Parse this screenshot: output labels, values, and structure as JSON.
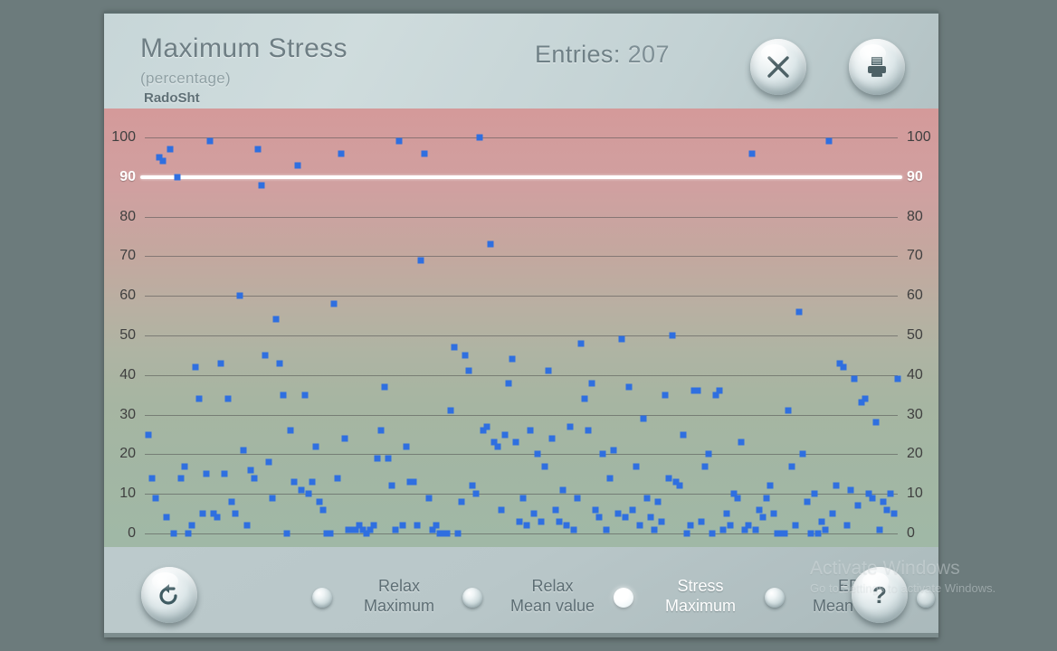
{
  "app": {
    "background_color": "#6c7b7c",
    "window_bg": "#b9c6c8"
  },
  "header": {
    "title": "Maximum Stress",
    "subtitle": "(percentage)",
    "username": "RadoSht",
    "entries_label": "Entries:",
    "entries_value": "207",
    "close_button": "close-icon",
    "print_button": "print-icon"
  },
  "footer": {
    "reset_button": "reset-icon",
    "help_button": "help-icon",
    "options": [
      {
        "line1": "Relax",
        "line2": "Maximum",
        "active": false
      },
      {
        "line1": "Relax",
        "line2": "Mean value",
        "active": false
      },
      {
        "line1": "Stress",
        "line2": "Maximum",
        "active": true
      },
      {
        "line1": "EDA",
        "line2": "Mean value",
        "active": false
      }
    ]
  },
  "watermark": {
    "line1": "Activate Windows",
    "line2": "Go to Settings to activate Windows."
  },
  "chart_data": {
    "type": "scatter",
    "title": "Maximum Stress",
    "subtitle": "(percentage)",
    "xlabel": "",
    "ylabel": "percentage",
    "ylim": [
      0,
      100
    ],
    "yticks": [
      0,
      10,
      20,
      30,
      40,
      50,
      60,
      70,
      80,
      90,
      100
    ],
    "grid": true,
    "legend": "none",
    "marker_color": "#2f6fe0",
    "marker_shape": "square",
    "threshold": {
      "value": 90,
      "color": "#ffffff",
      "label": "90"
    },
    "point_count": 207,
    "x_range": [
      0,
      207
    ],
    "points": [
      [
        1,
        25
      ],
      [
        2,
        14
      ],
      [
        3,
        9
      ],
      [
        4,
        95
      ],
      [
        5,
        94
      ],
      [
        6,
        4
      ],
      [
        7,
        97
      ],
      [
        8,
        0
      ],
      [
        9,
        90
      ],
      [
        10,
        14
      ],
      [
        11,
        17
      ],
      [
        12,
        0
      ],
      [
        13,
        2
      ],
      [
        14,
        42
      ],
      [
        15,
        34
      ],
      [
        16,
        5
      ],
      [
        17,
        15
      ],
      [
        18,
        99
      ],
      [
        19,
        5
      ],
      [
        20,
        4
      ],
      [
        21,
        43
      ],
      [
        22,
        15
      ],
      [
        23,
        34
      ],
      [
        24,
        8
      ],
      [
        25,
        5
      ],
      [
        26,
        60
      ],
      [
        27,
        21
      ],
      [
        28,
        2
      ],
      [
        29,
        16
      ],
      [
        30,
        14
      ],
      [
        31,
        97
      ],
      [
        32,
        88
      ],
      [
        33,
        45
      ],
      [
        34,
        18
      ],
      [
        35,
        9
      ],
      [
        36,
        54
      ],
      [
        37,
        43
      ],
      [
        38,
        35
      ],
      [
        39,
        0
      ],
      [
        40,
        26
      ],
      [
        41,
        13
      ],
      [
        42,
        93
      ],
      [
        43,
        11
      ],
      [
        44,
        35
      ],
      [
        45,
        10
      ],
      [
        46,
        13
      ],
      [
        47,
        22
      ],
      [
        48,
        8
      ],
      [
        49,
        6
      ],
      [
        50,
        0
      ],
      [
        51,
        0
      ],
      [
        52,
        58
      ],
      [
        53,
        14
      ],
      [
        54,
        96
      ],
      [
        55,
        24
      ],
      [
        56,
        1
      ],
      [
        57,
        1
      ],
      [
        58,
        1
      ],
      [
        59,
        2
      ],
      [
        60,
        1
      ],
      [
        61,
        0
      ],
      [
        62,
        1
      ],
      [
        63,
        2
      ],
      [
        64,
        19
      ],
      [
        65,
        26
      ],
      [
        66,
        37
      ],
      [
        67,
        19
      ],
      [
        68,
        12
      ],
      [
        69,
        1
      ],
      [
        70,
        99
      ],
      [
        71,
        2
      ],
      [
        72,
        22
      ],
      [
        73,
        13
      ],
      [
        74,
        13
      ],
      [
        75,
        2
      ],
      [
        76,
        69
      ],
      [
        77,
        96
      ],
      [
        78,
        9
      ],
      [
        79,
        1
      ],
      [
        80,
        2
      ],
      [
        81,
        0
      ],
      [
        82,
        0
      ],
      [
        83,
        0
      ],
      [
        84,
        31
      ],
      [
        85,
        47
      ],
      [
        86,
        0
      ],
      [
        87,
        8
      ],
      [
        88,
        45
      ],
      [
        89,
        41
      ],
      [
        90,
        12
      ],
      [
        91,
        10
      ],
      [
        92,
        100
      ],
      [
        93,
        26
      ],
      [
        94,
        27
      ],
      [
        95,
        73
      ],
      [
        96,
        23
      ],
      [
        97,
        22
      ],
      [
        98,
        6
      ],
      [
        99,
        25
      ],
      [
        100,
        38
      ],
      [
        101,
        44
      ],
      [
        102,
        23
      ],
      [
        103,
        3
      ],
      [
        104,
        9
      ],
      [
        105,
        2
      ],
      [
        106,
        26
      ],
      [
        107,
        5
      ],
      [
        108,
        20
      ],
      [
        109,
        3
      ],
      [
        110,
        17
      ],
      [
        111,
        41
      ],
      [
        112,
        24
      ],
      [
        113,
        6
      ],
      [
        114,
        3
      ],
      [
        115,
        11
      ],
      [
        116,
        2
      ],
      [
        117,
        27
      ],
      [
        118,
        1
      ],
      [
        119,
        9
      ],
      [
        120,
        48
      ],
      [
        121,
        34
      ],
      [
        122,
        26
      ],
      [
        123,
        38
      ],
      [
        124,
        6
      ],
      [
        125,
        4
      ],
      [
        126,
        20
      ],
      [
        127,
        1
      ],
      [
        128,
        14
      ],
      [
        129,
        21
      ],
      [
        130,
        5
      ],
      [
        131,
        49
      ],
      [
        132,
        4
      ],
      [
        133,
        37
      ],
      [
        134,
        6
      ],
      [
        135,
        17
      ],
      [
        136,
        2
      ],
      [
        137,
        29
      ],
      [
        138,
        9
      ],
      [
        139,
        4
      ],
      [
        140,
        1
      ],
      [
        141,
        8
      ],
      [
        142,
        3
      ],
      [
        143,
        35
      ],
      [
        144,
        14
      ],
      [
        145,
        50
      ],
      [
        146,
        13
      ],
      [
        147,
        12
      ],
      [
        148,
        25
      ],
      [
        149,
        0
      ],
      [
        150,
        2
      ],
      [
        151,
        36
      ],
      [
        152,
        36
      ],
      [
        153,
        3
      ],
      [
        154,
        17
      ],
      [
        155,
        20
      ],
      [
        156,
        0
      ],
      [
        157,
        35
      ],
      [
        158,
        36
      ],
      [
        159,
        1
      ],
      [
        160,
        5
      ],
      [
        161,
        2
      ],
      [
        162,
        10
      ],
      [
        163,
        9
      ],
      [
        164,
        23
      ],
      [
        165,
        1
      ],
      [
        166,
        2
      ],
      [
        167,
        96
      ],
      [
        168,
        1
      ],
      [
        169,
        6
      ],
      [
        170,
        4
      ],
      [
        171,
        9
      ],
      [
        172,
        12
      ],
      [
        173,
        5
      ],
      [
        174,
        0
      ],
      [
        175,
        0
      ],
      [
        176,
        0
      ],
      [
        177,
        31
      ],
      [
        178,
        17
      ],
      [
        179,
        2
      ],
      [
        180,
        56
      ],
      [
        181,
        20
      ],
      [
        182,
        8
      ],
      [
        183,
        0
      ],
      [
        184,
        10
      ],
      [
        185,
        0
      ],
      [
        186,
        3
      ],
      [
        187,
        1
      ],
      [
        188,
        99
      ],
      [
        189,
        5
      ],
      [
        190,
        12
      ],
      [
        191,
        43
      ],
      [
        192,
        42
      ],
      [
        193,
        2
      ],
      [
        194,
        11
      ],
      [
        195,
        39
      ],
      [
        196,
        7
      ],
      [
        197,
        33
      ],
      [
        198,
        34
      ],
      [
        199,
        10
      ],
      [
        200,
        9
      ],
      [
        201,
        28
      ],
      [
        202,
        1
      ],
      [
        203,
        8
      ],
      [
        204,
        6
      ],
      [
        205,
        10
      ],
      [
        206,
        5
      ],
      [
        207,
        39
      ]
    ]
  }
}
